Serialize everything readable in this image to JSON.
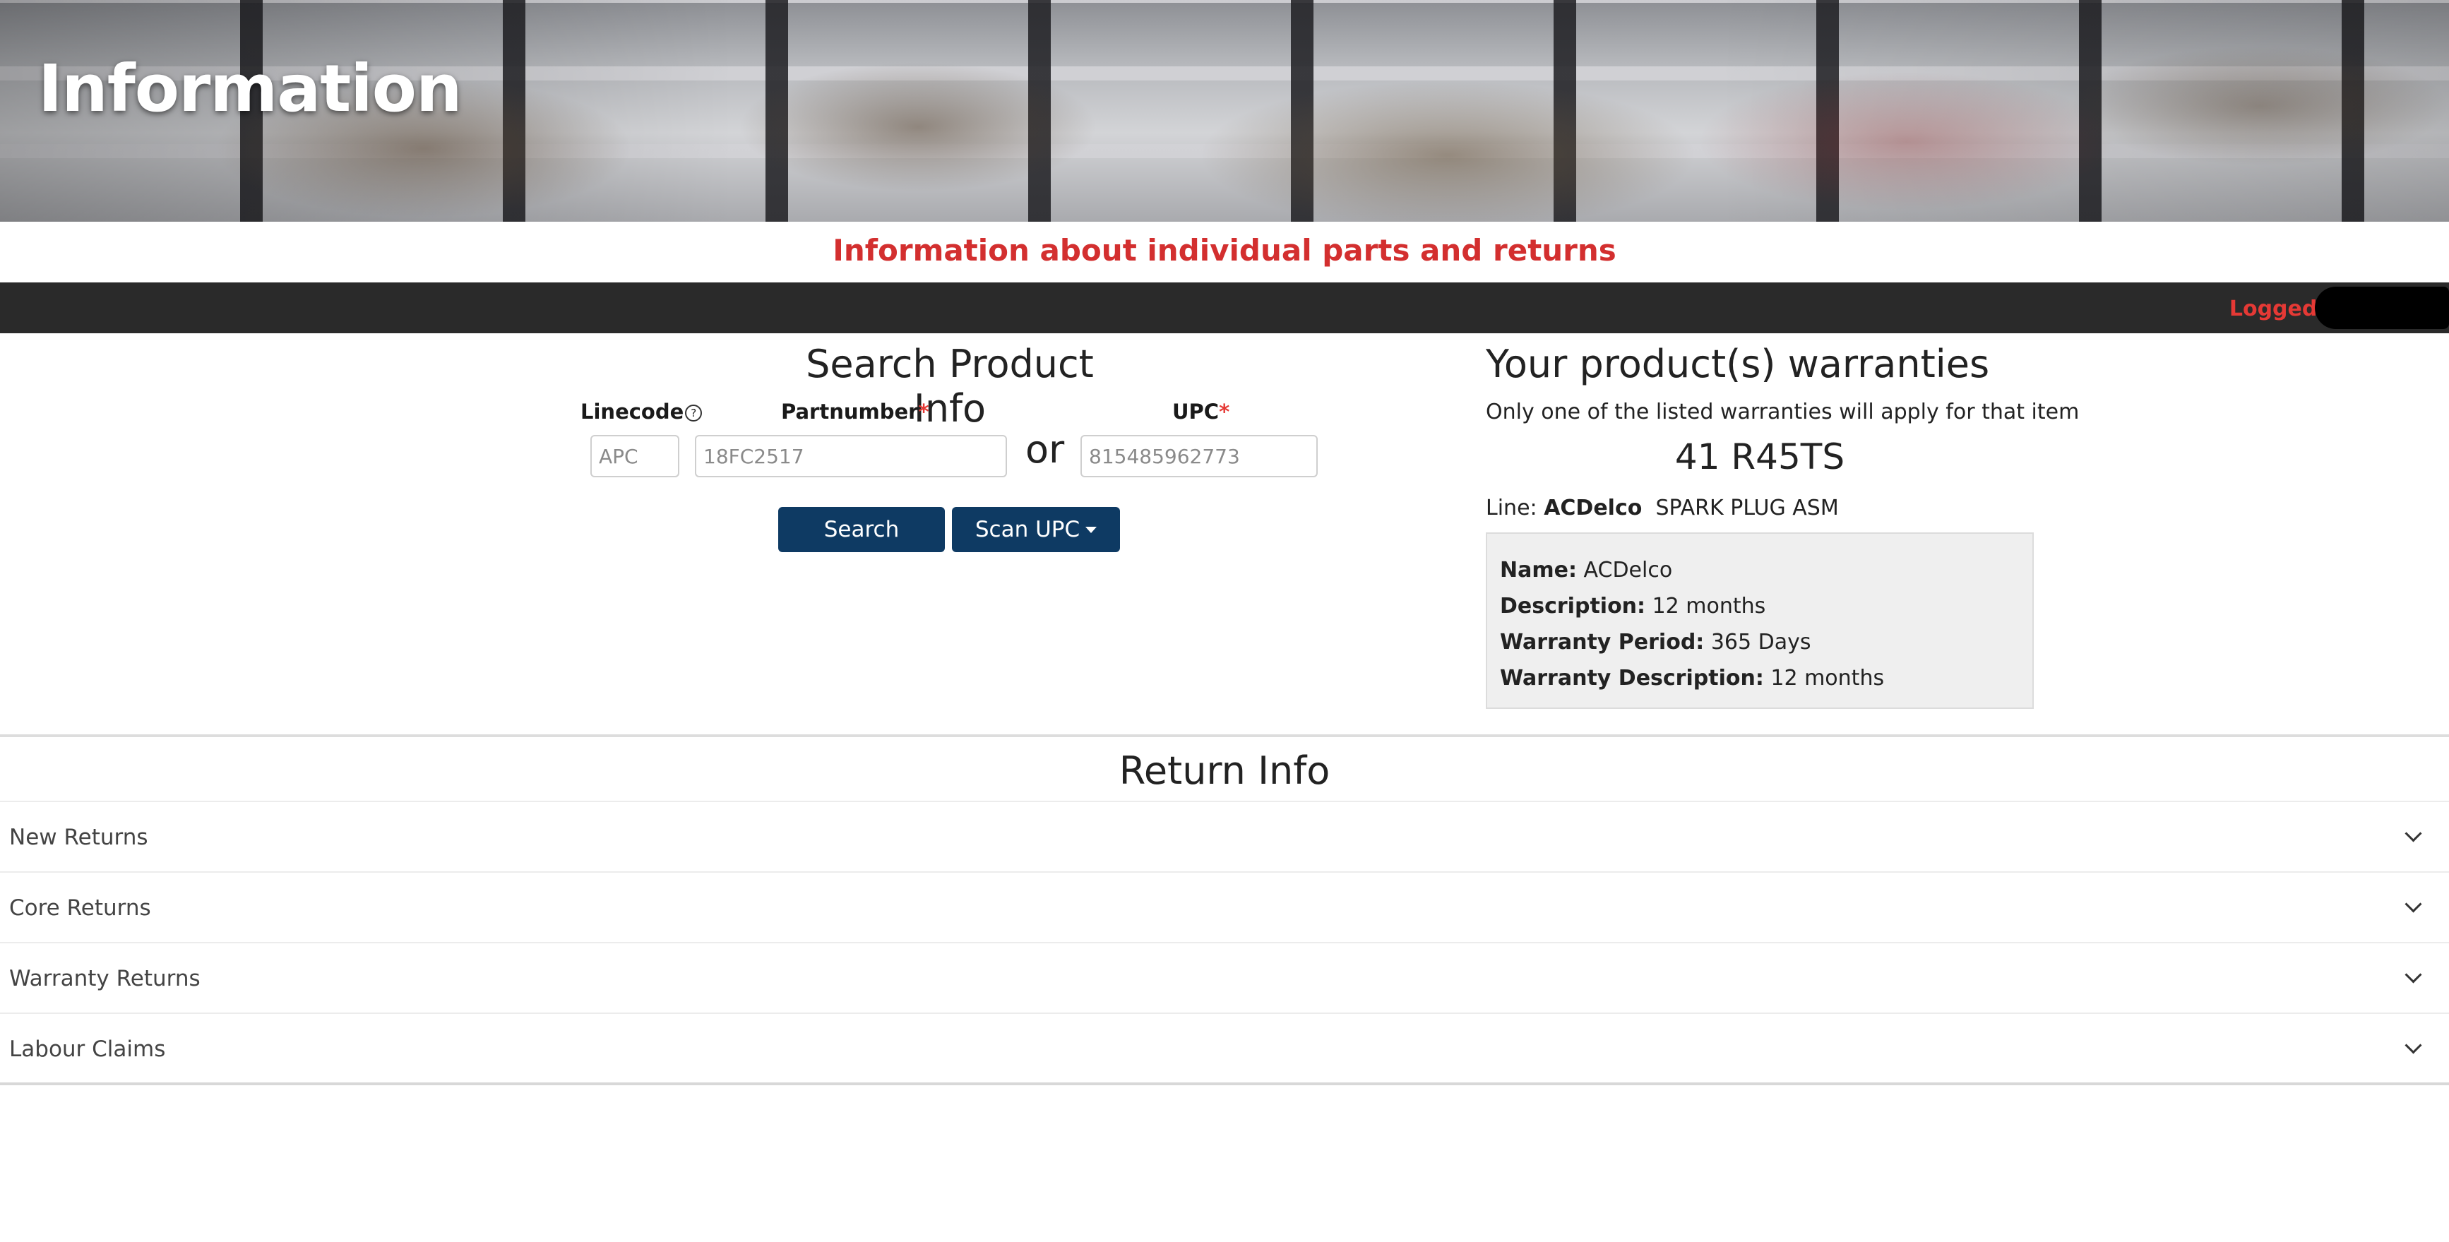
{
  "banner": {
    "title": "Information"
  },
  "subtitle": "Information about individual parts and returns",
  "status": {
    "logged_in_label": "Logged in as"
  },
  "search": {
    "title": "Search Product Info",
    "linecode_label": "Linecode",
    "linecode_placeholder": "APC",
    "partnumber_label": "Partnumber",
    "partnumber_placeholder": "18FC2517",
    "or_text": "or",
    "upc_label": "UPC",
    "upc_placeholder": "815485962773",
    "required_mark": "*",
    "help_glyph": "?",
    "search_button": "Search",
    "scan_button": "Scan UPC"
  },
  "warranty": {
    "title": "Your product(s) warranties",
    "note": "Only one of the listed warranties will apply for that item",
    "part": "41 R45TS",
    "line_label": "Line:",
    "line_brand": "ACDelco",
    "line_desc": "SPARK PLUG ASM",
    "details": [
      {
        "label": "Name:",
        "value": "ACDelco"
      },
      {
        "label": "Description:",
        "value": "12 months"
      },
      {
        "label": "Warranty Period:",
        "value": "365 Days"
      },
      {
        "label": "Warranty Description:",
        "value": "12 months"
      }
    ]
  },
  "returns": {
    "title": "Return Info",
    "items": [
      {
        "label": "New Returns"
      },
      {
        "label": "Core Returns"
      },
      {
        "label": "Warranty Returns"
      },
      {
        "label": "Labour Claims"
      }
    ]
  },
  "colors": {
    "accent_red": "#d32f2f",
    "button_navy": "#0e3a63",
    "status_bar": "#2a2a2a"
  }
}
